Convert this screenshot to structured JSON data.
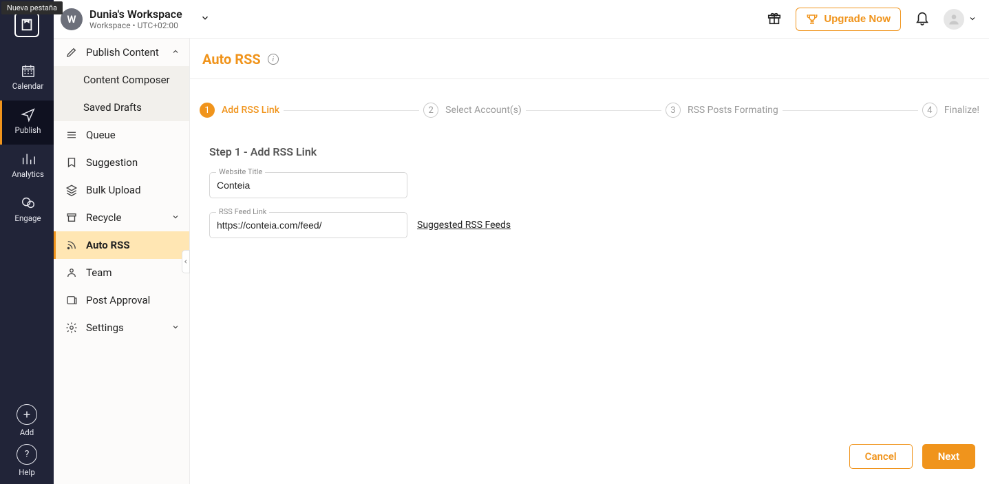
{
  "tooltip": "Nueva pestaña",
  "workspace": {
    "letter": "W",
    "title": "Dunia's Workspace",
    "subtitle": "Workspace • UTC+02:00"
  },
  "header": {
    "upgrade_label": "Upgrade Now"
  },
  "rail": {
    "items": [
      {
        "label": "Calendar"
      },
      {
        "label": "Publish"
      },
      {
        "label": "Analytics"
      },
      {
        "label": "Engage"
      }
    ],
    "add_label": "Add",
    "help_label": "Help"
  },
  "sidebar": {
    "publish_content": "Publish Content",
    "content_composer": "Content Composer",
    "saved_drafts": "Saved Drafts",
    "queue": "Queue",
    "suggestion": "Suggestion",
    "bulk_upload": "Bulk Upload",
    "recycle": "Recycle",
    "auto_rss": "Auto RSS",
    "team": "Team",
    "post_approval": "Post Approval",
    "settings": "Settings"
  },
  "page": {
    "title": "Auto RSS",
    "steps": [
      {
        "num": "1",
        "label": "Add RSS Link"
      },
      {
        "num": "2",
        "label": "Select Account(s)"
      },
      {
        "num": "3",
        "label": "RSS Posts Formating"
      },
      {
        "num": "4",
        "label": "Finalize!"
      }
    ],
    "form": {
      "heading": "Step 1 - Add RSS Link",
      "website_title_label": "Website Title",
      "website_title_value": "Conteia",
      "rss_link_label": "RSS Feed Link",
      "rss_link_value": "https://conteia.com/feed/",
      "suggested_link": "Suggested RSS Feeds"
    },
    "footer": {
      "cancel": "Cancel",
      "next": "Next"
    }
  }
}
